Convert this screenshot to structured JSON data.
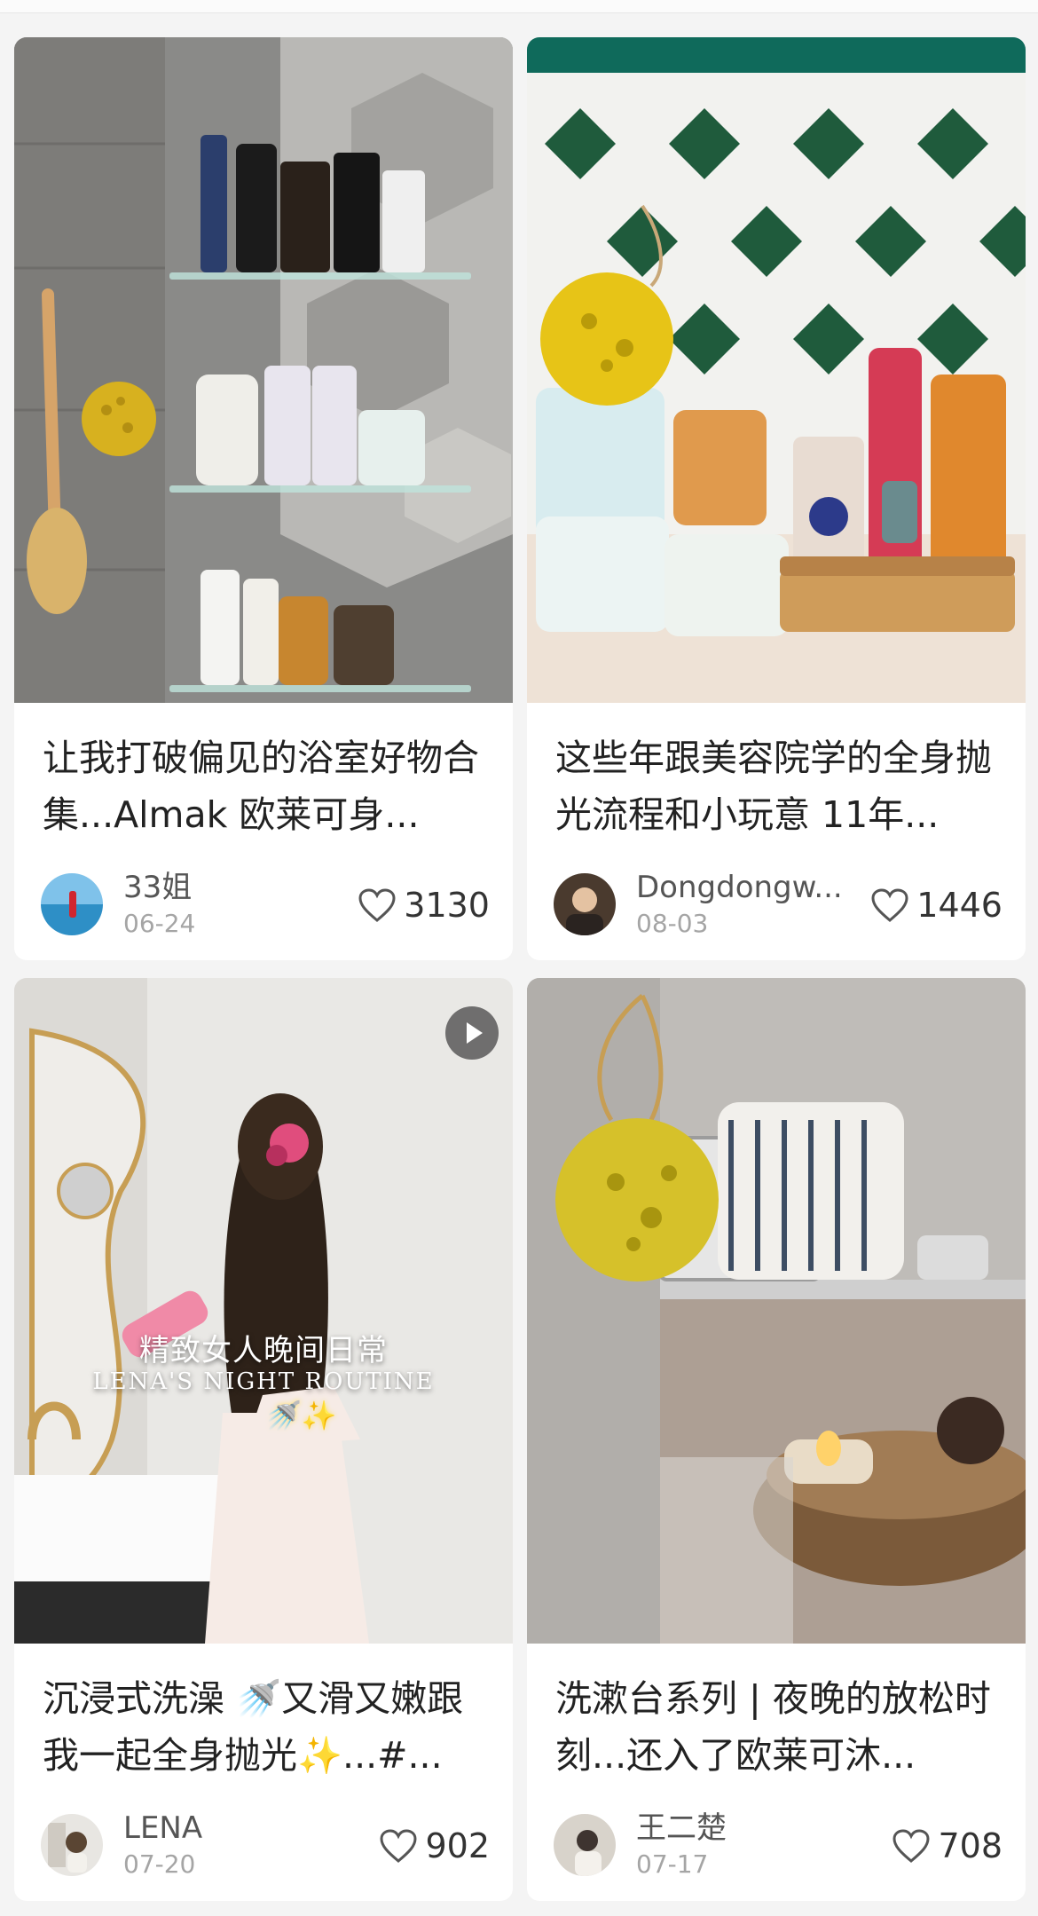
{
  "feed": {
    "cards": [
      {
        "title": "让我打破偏见的浴室好物合集...Almak 欧莱可身...",
        "author": "33姐",
        "date": "06-24",
        "likes": "3130",
        "image": "bathroom-shelves-photo"
      },
      {
        "title": "这些年跟美容院学的全身抛光流程和小玩意 11年...",
        "author": "Dongdongw...",
        "date": "08-03",
        "likes": "1446",
        "image": "body-care-products-photo"
      },
      {
        "title": "沉浸式洗澡 🚿又滑又嫩跟我一起全身抛光✨...#...",
        "author": "LENA",
        "date": "07-20",
        "likes": "902",
        "image": "night-routine-video",
        "overlay_title": "精致女人晚间日常",
        "overlay_subtitle": "LENA'S NIGHT ROUTINE",
        "overlay_emoji": "🚿✨"
      },
      {
        "title": "洗漱台系列 | 夜晚的放松时刻...还入了欧莱可沐...",
        "author": "王二楚",
        "date": "07-17",
        "likes": "708",
        "image": "washstand-candle-photo"
      }
    ]
  },
  "colors": {
    "background": "#f4f4f4",
    "card": "#ffffff",
    "title_text": "#222222",
    "meta_text": "#a5a5a5"
  },
  "icons": {
    "like": "heart-outline-icon",
    "video": "play-icon"
  }
}
